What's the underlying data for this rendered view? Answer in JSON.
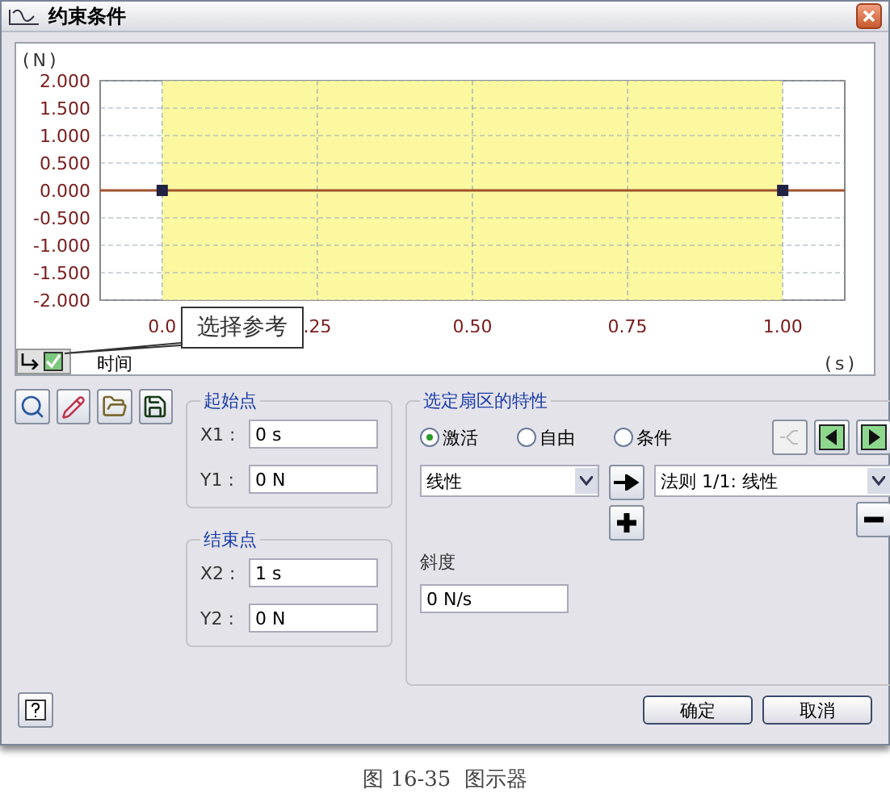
{
  "window": {
    "title": "约束条件"
  },
  "chart": {
    "y_unit": "(N)",
    "x_unit": "(s)",
    "x_axis_label": "时间",
    "reference_checked": true,
    "callout": "选择参考",
    "chart_data": {
      "type": "line",
      "x": [
        -0.1,
        0,
        1,
        1.1
      ],
      "grid": true,
      "series": [
        {
          "color": "#a0522d",
          "values": [
            0,
            0,
            0,
            0
          ],
          "marker": "square"
        }
      ],
      "xlim": [
        -0.1,
        1.1
      ],
      "ylim": [
        -2,
        2
      ],
      "xticks": [
        {
          "value": 0,
          "label": "0.0"
        },
        {
          "value": 0.25,
          "label": ".25"
        },
        {
          "value": 0.5,
          "label": "0.50"
        },
        {
          "value": 0.75,
          "label": "0.75"
        },
        {
          "value": 1,
          "label": "1.00"
        }
      ],
      "yticks": [
        {
          "value": 2,
          "label": "2.000"
        },
        {
          "value": 1.5,
          "label": "1.500"
        },
        {
          "value": 1,
          "label": "1.000"
        },
        {
          "value": 0.5,
          "label": "0.500"
        },
        {
          "value": 0,
          "label": "0.000"
        },
        {
          "value": -0.5,
          "label": "-0.500"
        },
        {
          "value": -1,
          "label": "-1.000"
        },
        {
          "value": -1.5,
          "label": "-1.500"
        },
        {
          "value": -2,
          "label": "-2.000"
        }
      ],
      "bands": [
        {
          "axis": "x",
          "from": 0,
          "to": 1,
          "color": "#fbf8a0"
        }
      ]
    }
  },
  "start_point": {
    "title": "起始点",
    "fields": [
      {
        "label": "X1 :",
        "value": "0 s"
      },
      {
        "label": "Y1 :",
        "value": "0 N"
      }
    ]
  },
  "end_point": {
    "title": "结束点",
    "fields": [
      {
        "label": "X2 :",
        "value": "1 s"
      },
      {
        "label": "Y2 :",
        "value": "0 N"
      }
    ]
  },
  "sector": {
    "title": "选定扇区的特性",
    "modes": [
      {
        "label": "激活",
        "selected": true
      },
      {
        "label": "自由",
        "selected": false
      },
      {
        "label": "条件",
        "selected": false
      }
    ],
    "type_select": "线性",
    "law_select": "法则 1/1: 线性",
    "slope_label": "斜度",
    "slope_value": "0 N/s"
  },
  "buttons": [
    "确定",
    "取消"
  ],
  "caption": "图 16-35  图示器"
}
